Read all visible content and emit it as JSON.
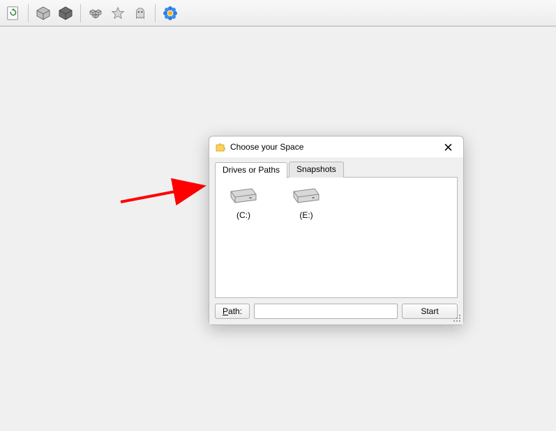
{
  "toolbar": {
    "icons": [
      "refresh",
      "cube",
      "dark-cube",
      "boxes",
      "star",
      "ghost",
      "flower"
    ]
  },
  "dialog": {
    "title": "Choose your Space",
    "tabs": [
      {
        "id": "drives",
        "label": "Drives or Paths",
        "active": true
      },
      {
        "id": "snapshots",
        "label": "Snapshots",
        "active": false
      }
    ],
    "drives": [
      {
        "label": "(C:)"
      },
      {
        "label": "(E:)"
      }
    ],
    "path_button": "Path:",
    "path_value": "",
    "start_button": "Start"
  },
  "arrow": {
    "color": "#ff0000"
  }
}
